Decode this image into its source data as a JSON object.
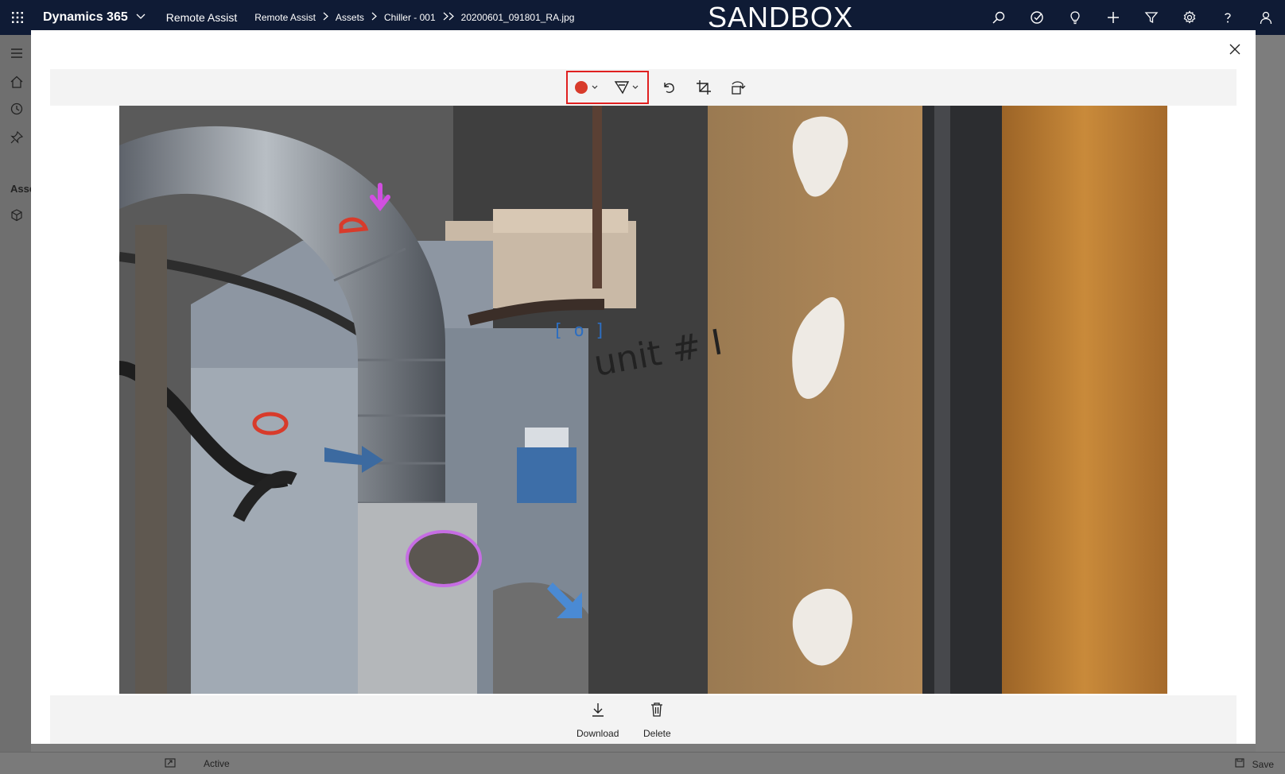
{
  "topbar": {
    "app_name": "Dynamics 365",
    "area": "Remote Assist",
    "breadcrumbs": [
      "Remote Assist",
      "Assets",
      "Chiller - 001",
      "20200601_091801_RA.jpg"
    ],
    "environment_label": "SANDBOX",
    "icons": [
      "search-icon",
      "task-icon",
      "lightbulb-icon",
      "plus-icon",
      "filter-icon",
      "gear-icon",
      "help-icon",
      "user-icon"
    ]
  },
  "rail": {
    "section_label": "Asse"
  },
  "status": {
    "state": "Active",
    "save_label": "Save"
  },
  "viewer": {
    "toolbar": {
      "pen_color": "#d83b2b",
      "tools": [
        "color-picker",
        "pen-tool",
        "undo",
        "crop",
        "rotate"
      ]
    },
    "footer": {
      "download_label": "Download",
      "delete_label": "Delete"
    },
    "photo_annotations": {
      "handwriting": "unit # I"
    }
  }
}
